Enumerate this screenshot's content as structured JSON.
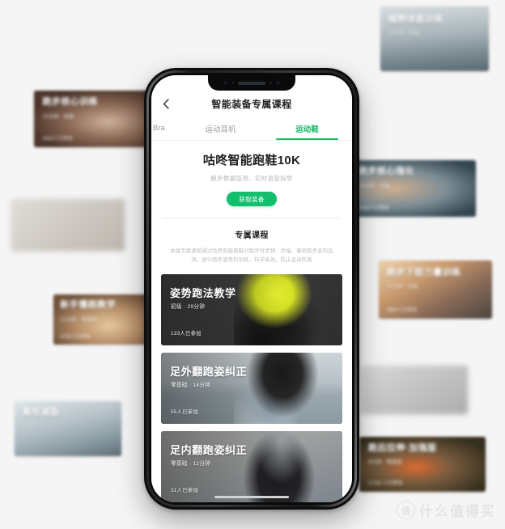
{
  "watermark": {
    "text": "什么值得买",
    "logo_glyph": "值"
  },
  "phone": {
    "app": {
      "back_icon": "chevron-left-icon",
      "title": "智能装备专属课程",
      "tabs": [
        {
          "label": "Bra",
          "active": false,
          "partial": true
        },
        {
          "label": "运动耳机",
          "active": false,
          "partial": false
        },
        {
          "label": "运动鞋",
          "active": true,
          "partial": false
        }
      ],
      "hero": {
        "product_title": "咕咚智能跑鞋10K",
        "product_subtitle": "跑步数据监测、实时语音指导",
        "cta_label": "获取装备",
        "accent_color": "#13bf6d"
      },
      "section": {
        "heading": "专属课程",
        "description": "本组专属课程通过咕咚智能跑鞋对跑步时步频、步幅、着地和步态的监测，进行跑步姿势的训练，科学高效，防止运动伤害"
      },
      "courses": [
        {
          "title": "姿势跑法教学",
          "meta": "初级 · 29分钟",
          "joined": "133人已参加"
        },
        {
          "title": "足外翻跑姿纠正",
          "meta": "零基础 · 14分钟",
          "joined": "55人已参加"
        },
        {
          "title": "足内翻跑姿纠正",
          "meta": "零基础 · 12分钟",
          "joined": "31人已参加"
        }
      ]
    }
  },
  "background_cards": [
    {
      "title": "跑步核心训练",
      "meta": "15分钟 · 初级",
      "joined": "6283人已参加"
    },
    {
      "title": "新手慢跑教学",
      "meta": "21分钟 · 零基础",
      "joined": "8765人已参加"
    },
    {
      "title": "高效减脂",
      "meta": "",
      "joined": ""
    },
    {
      "title": "跑步核心强化",
      "meta": "20分钟 · 中级",
      "joined": "3538人已参加"
    },
    {
      "title": "跑步下肢力量训练",
      "meta": "21分钟 · 初级",
      "joined": "3884人已参加"
    },
    {
      "title": "跑后拉伸·加强版",
      "meta": "8分钟 · 零基础",
      "joined": "17132 人已参加"
    },
    {
      "title": "越野体能训练",
      "meta": "30分钟 · 高级",
      "joined": ""
    }
  ]
}
